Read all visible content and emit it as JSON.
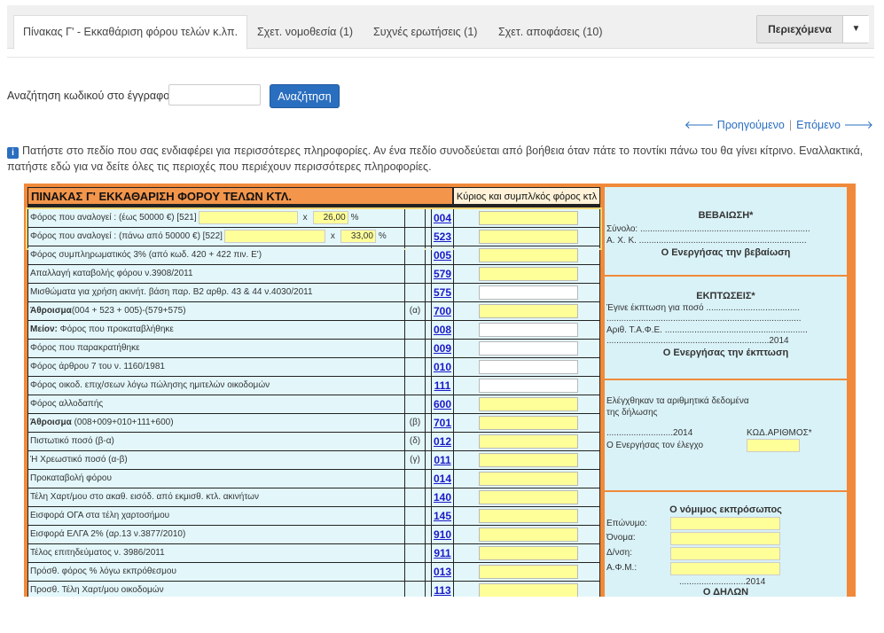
{
  "tabs": [
    {
      "label": "Πίνακας Γ' - Εκκαθάριση φόρου τελών κ.λπ."
    },
    {
      "label": "Σχετ. νομοθεσία (1)"
    },
    {
      "label": "Συχνές ερωτήσεις (1)"
    },
    {
      "label": "Σχετ. αποφάσεις (10)"
    }
  ],
  "toc": {
    "label": "Περιεχόμενα",
    "caret": "▼"
  },
  "search": {
    "label": "Αναζήτηση κωδικού στο έγγραφο:",
    "placeholder": "",
    "value": "",
    "button": "Αναζήτηση"
  },
  "nav": {
    "prev": "🡐 Προηγούμενο",
    "sep": "|",
    "next": "Επόμενο 🡒"
  },
  "info": {
    "icon": "i",
    "text": "Πατήστε στο πεδίο που σας ενδιαφέρει για περισσότερες πληροφορίες. Αν ένα πεδίο συνοδεύεται από βοήθεια όταν πάτε το ποντίκι πάνω του θα γίνει κίτρινο. Εναλλακτικά, πατήστε εδώ για να δείτε όλες τις περιοχές που περιέχουν περισσότερες πληροφορίες."
  },
  "form": {
    "title": "ΠΙΝΑΚΑΣ Γ' ΕΚΚΑΘΑΡΙΣΗ ΦΟΡΟΥ ΤΕΛΩΝ ΚΤΛ.",
    "amount_header": "Κύριος και συμπλ/κός φόρος κτλ",
    "row1": {
      "label": "Φόρος που αναλογεί : (έως 50000 €) [521]",
      "x": "x",
      "rate": "26,00",
      "pct": "%",
      "code": "004"
    },
    "row2": {
      "label": "Φόρος που αναλογεί : (πάνω από 50000 €) [522]",
      "x": "x",
      "rate": "33,00",
      "pct": "%",
      "code": "523"
    },
    "rows": [
      {
        "label": "Φόρος συμπληρωματικός 3% (από κωδ. 420 + 422 πιν. Ε')",
        "mark": "",
        "code": "005",
        "field": "yellow"
      },
      {
        "label": "Απαλλαγή καταβολής φόρου ν.3908/2011",
        "mark": "",
        "code": "579",
        "field": "yellow"
      },
      {
        "label": "Μισθώματα για χρήση ακινήτ. βάση παρ. Β2 αρθρ. 43 & 44 ν.4030/2011",
        "mark": "",
        "code": "575",
        "field": "white"
      },
      {
        "bold": "Άθροισμα",
        "label": "(004 + 523 + 005)-(579+575)",
        "mark": "(α)",
        "code": "700",
        "field": "yellow"
      },
      {
        "bold": "Μείον:",
        "label": " Φόρος που προκαταβλήθηκε",
        "mark": "",
        "code": "008",
        "field": "white"
      },
      {
        "label": "Φόρος που παρακρατήθηκε",
        "mark": "",
        "code": "009",
        "field": "white"
      },
      {
        "label": "Φόρος άρθρου 7 του ν. 1160/1981",
        "mark": "",
        "code": "010",
        "field": "white"
      },
      {
        "label": "Φόρος οικοδ. επιχ/σεων λόγω πώλησης ημιτελών οικοδομών",
        "mark": "",
        "code": "111",
        "field": "white"
      },
      {
        "label": "Φόρος αλλοδαπής",
        "mark": "",
        "code": "600",
        "field": "yellow"
      },
      {
        "bold": "Άθροισμα",
        "label": " (008+009+010+111+600)",
        "mark": "(β)",
        "code": "701",
        "field": "yellow"
      },
      {
        "label": "Πιστωτικό ποσό (β-α)",
        "mark": "(δ)",
        "code": "012",
        "field": "yellow"
      },
      {
        "label": "Ή Χρεωστικό ποσό (α-β)",
        "mark": "(γ)",
        "code": "011",
        "field": "yellow"
      },
      {
        "label": "Προκαταβολή φόρου",
        "mark": "",
        "code": "014",
        "field": "yellow"
      },
      {
        "label": "Τέλη Χαρτ/μου στο ακαθ. εισόδ. από εκμισθ. κτλ. ακινήτων",
        "mark": "",
        "code": "140",
        "field": "yellow"
      },
      {
        "label": "Εισφορά ΟΓΑ στα τέλη χαρτοσήμου",
        "mark": "",
        "code": "145",
        "field": "yellow"
      },
      {
        "label": "Εισφορά ΕΛΓΑ 2% (αρ.13 ν.3877/2010)",
        "mark": "",
        "code": "910",
        "field": "yellow"
      },
      {
        "label": "Τέλος επιτηδεύματος ν. 3986/2011",
        "mark": "",
        "code": "911",
        "field": "yellow"
      },
      {
        "label": "Πρόσθ. φόρος % λόγω εκπρόθεσμου",
        "mark": "",
        "code": "013",
        "field": "yellow"
      },
      {
        "label": "Προσθ. Τέλη Χαρτ/μου οικοδομών",
        "mark": "",
        "code": "113",
        "field": "yellow"
      }
    ],
    "right": {
      "cert_title": "ΒΕΒΑΙΩΣΗ*",
      "cert_sum": "Σύνολο: .....................................................................",
      "cert_axk": "Α. Χ. Κ. ....................................................................",
      "cert_sign": "Ο Ενεργήσας την βεβαίωση",
      "disc_title": "ΕΚΠΤΩΣΕΙΣ*",
      "disc_l1": "Έγινε έκπτωση για ποσό ......................................",
      "disc_l2": "...............................................................................",
      "disc_l3": "Αριθ. Τ.Α.Φ.Ε. ..........................................................",
      "disc_l4": "..................................................................2014",
      "disc_sign": "Ο Ενεργήσας την έκπτωση",
      "check_l1": "Ελέγχθηκαν τα αριθμητικά δεδομένα",
      "check_l2": "της δήλωσης",
      "check_date": "...........................2014",
      "check_code": "ΚΩΔ.ΑΡΙΘΜΟΣ*",
      "check_sign": "Ο Ενεργήσας τον έλεγχο",
      "rep_title": "Ο νόμιμος εκπρόσωπος",
      "rep_surname": "Επώνυμο:",
      "rep_name": "Όνομα:",
      "rep_addr": "Δ/νση:",
      "rep_afm": "Α.Φ.Μ.:",
      "rep_date": "...........................2014",
      "rep_sign": "Ο ΔΗΛΩΝ"
    }
  }
}
